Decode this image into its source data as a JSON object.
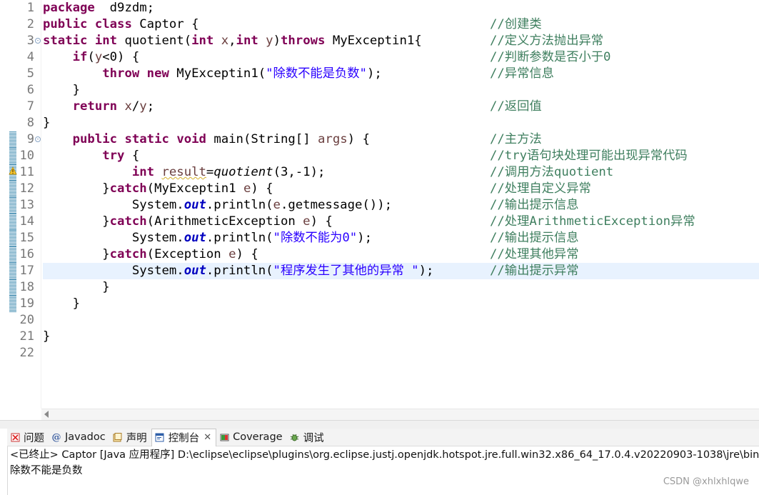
{
  "editor": {
    "lines": [
      {
        "n": "1",
        "tokens": [
          [
            "kw",
            "package"
          ],
          [
            "",
            "  d9zdm;"
          ]
        ],
        "comment": ""
      },
      {
        "n": "2",
        "tokens": [
          [
            "kw",
            "public"
          ],
          [
            "",
            " "
          ],
          [
            "kw",
            "class"
          ],
          [
            "",
            " Captor {"
          ]
        ],
        "comment": "//创建类"
      },
      {
        "n": "3",
        "fold": true,
        "tokens": [
          [
            "kw",
            "static"
          ],
          [
            "",
            " "
          ],
          [
            "kw",
            "int"
          ],
          [
            "",
            " quotient("
          ],
          [
            "kw",
            "int"
          ],
          [
            "",
            " "
          ],
          [
            "var",
            "x"
          ],
          [
            ","
          ],
          [
            "kw",
            "int"
          ],
          [
            "",
            " "
          ],
          [
            "var",
            "y"
          ],
          [
            ")"
          ],
          [
            "kw",
            "throws"
          ],
          [
            "",
            " MyExceptin1{"
          ]
        ],
        "comment": "//定义方法抛出异常"
      },
      {
        "n": "4",
        "tokens": [
          [
            "",
            "    "
          ],
          [
            "kw",
            "if"
          ],
          [
            "",
            "("
          ],
          [
            "var",
            "y"
          ],
          [
            "",
            "<0) {"
          ]
        ],
        "comment": "//判断参数是否小于0"
      },
      {
        "n": "5",
        "tokens": [
          [
            "",
            "        "
          ],
          [
            "kw",
            "throw"
          ],
          [
            "",
            " "
          ],
          [
            "kw",
            "new"
          ],
          [
            "",
            " MyExceptin1("
          ],
          [
            "str",
            "\"除数不能是负数\""
          ],
          [
            "",
            ");"
          ]
        ],
        "comment": "//异常信息"
      },
      {
        "n": "6",
        "tokens": [
          [
            "",
            "    }"
          ]
        ],
        "comment": ""
      },
      {
        "n": "7",
        "tokens": [
          [
            "",
            "    "
          ],
          [
            "kw",
            "return"
          ],
          [
            "",
            " "
          ],
          [
            "var",
            "x"
          ],
          [
            "",
            "/"
          ],
          [
            "var",
            "y"
          ],
          [
            "",
            ";"
          ]
        ],
        "comment": "//返回值"
      },
      {
        "n": "8",
        "tokens": [
          [
            "",
            "}"
          ]
        ],
        "comment": ""
      },
      {
        "n": "9",
        "fold": true,
        "tokens": [
          [
            "",
            "    "
          ],
          [
            "kw",
            "public"
          ],
          [
            "",
            " "
          ],
          [
            "kw",
            "static"
          ],
          [
            "",
            " "
          ],
          [
            "kw",
            "void"
          ],
          [
            "",
            " main(String[] "
          ],
          [
            "var",
            "args"
          ],
          [
            ") {"
          ]
        ],
        "comment": "//主方法"
      },
      {
        "n": "10",
        "tokens": [
          [
            "",
            "        "
          ],
          [
            "kw",
            "try"
          ],
          [
            "",
            " {"
          ]
        ],
        "comment": "//try语句块处理可能出现异常代码"
      },
      {
        "n": "11",
        "tokens": [
          [
            "",
            "            "
          ],
          [
            "kw",
            "int"
          ],
          [
            "",
            " "
          ],
          [
            "var unused",
            "result"
          ],
          [
            "",
            "="
          ],
          [
            "st",
            "quotient"
          ],
          [
            "",
            "(3,-1);"
          ]
        ],
        "comment": "//调用方法quotient"
      },
      {
        "n": "12",
        "tokens": [
          [
            "",
            "        }"
          ],
          [
            "kw",
            "catch"
          ],
          [
            "",
            "(MyExceptin1 "
          ],
          [
            "var",
            "e"
          ],
          [
            ") {"
          ]
        ],
        "comment": "//处理自定义异常"
      },
      {
        "n": "13",
        "tokens": [
          [
            "",
            "            System."
          ],
          [
            "fld",
            "out"
          ],
          [
            "",
            ".println("
          ],
          [
            "var",
            "e"
          ],
          [
            "",
            ".getmessage());"
          ]
        ],
        "comment": "//输出提示信息"
      },
      {
        "n": "14",
        "tokens": [
          [
            "",
            "        }"
          ],
          [
            "kw",
            "catch"
          ],
          [
            "",
            "(ArithmeticException "
          ],
          [
            "var",
            "e"
          ],
          [
            ") {"
          ]
        ],
        "comment": "//处理ArithmeticException异常"
      },
      {
        "n": "15",
        "tokens": [
          [
            "",
            "            System."
          ],
          [
            "fld",
            "out"
          ],
          [
            "",
            ".println("
          ],
          [
            "str",
            "\"除数不能为0\""
          ],
          [
            "",
            ");"
          ]
        ],
        "comment": "//输出提示信息"
      },
      {
        "n": "16",
        "tokens": [
          [
            "",
            "        }"
          ],
          [
            "kw",
            "catch"
          ],
          [
            "",
            "(Exception "
          ],
          [
            "var",
            "e"
          ],
          [
            ") {"
          ]
        ],
        "comment": "//处理其他异常"
      },
      {
        "n": "17",
        "current": true,
        "tokens": [
          [
            "",
            "            System."
          ],
          [
            "fld",
            "out"
          ],
          [
            "",
            ".println("
          ],
          [
            "str",
            "\"程序发生了其他的异常 \""
          ],
          [
            "",
            ");"
          ]
        ],
        "comment": "//输出提示异常"
      },
      {
        "n": "18",
        "tokens": [
          [
            "",
            "        }"
          ]
        ],
        "comment": ""
      },
      {
        "n": "19",
        "tokens": [
          [
            "",
            "    }"
          ]
        ],
        "comment": ""
      },
      {
        "n": "20",
        "tokens": [],
        "comment": ""
      },
      {
        "n": "21",
        "tokens": [
          [
            "",
            "}"
          ]
        ],
        "comment": ""
      },
      {
        "n": "22",
        "tokens": [],
        "comment": ""
      }
    ]
  },
  "console": {
    "tabs": [
      {
        "label": "问题",
        "icon": "problems-icon"
      },
      {
        "label": "Javadoc",
        "icon": "javadoc-icon"
      },
      {
        "label": "声明",
        "icon": "declaration-icon"
      },
      {
        "label": "控制台",
        "icon": "console-icon",
        "active": true
      },
      {
        "label": "Coverage",
        "icon": "coverage-icon"
      },
      {
        "label": "调试",
        "icon": "debug-icon"
      }
    ],
    "status": "<已终止> Captor [Java 应用程序] D:\\eclipse\\eclipse\\plugins\\org.eclipse.justj.openjdk.hotspot.jre.full.win32.x86_64_17.0.4.v20220903-1038\\jre\\bin",
    "output": "除数不能是负数"
  },
  "watermark": "CSDN @xhlxhlqwe"
}
